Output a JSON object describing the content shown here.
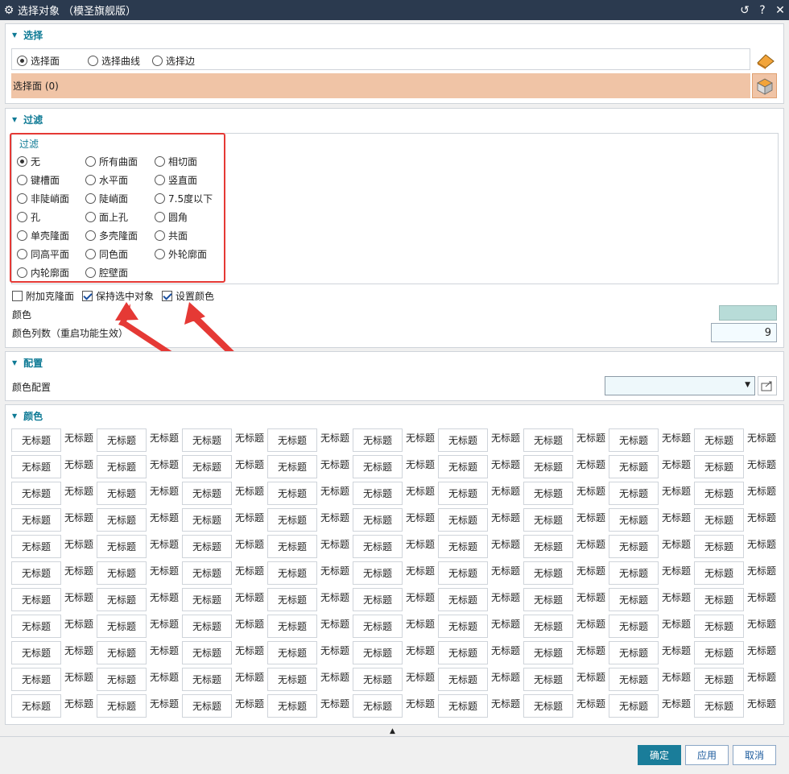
{
  "window": {
    "title": "选择对象 （模圣旗舰版）"
  },
  "select_section": {
    "title": "选择",
    "options": [
      {
        "label": "选择面",
        "selected": true
      },
      {
        "label": "选择曲线",
        "selected": false
      },
      {
        "label": "选择边",
        "selected": false
      }
    ],
    "selection_status": "选择面 (0)",
    "highlight_color": "#f0c4a6"
  },
  "filter_section": {
    "title": "过滤",
    "group_label": "过滤",
    "options": [
      [
        "无",
        "所有曲面",
        "相切面"
      ],
      [
        "键槽面",
        "水平面",
        "竖直面"
      ],
      [
        "非陡峭面",
        "陡峭面",
        "7.5度以下"
      ],
      [
        "孔",
        "面上孔",
        "圆角"
      ],
      [
        "单壳隆面",
        "多壳隆面",
        "共面"
      ],
      [
        "同高平面",
        "同色面",
        "外轮廓面"
      ],
      [
        "内轮廓面",
        "腔壁面",
        ""
      ]
    ],
    "selected": "无",
    "checkboxes": [
      {
        "label": "附加克隆面",
        "checked": false
      },
      {
        "label": "保持选中对象",
        "checked": true
      },
      {
        "label": "设置颜色",
        "checked": true
      }
    ],
    "color_label": "颜色",
    "color_value": "#b8dcd8",
    "color_count_label": "颜色列数（重启功能生效）",
    "color_count_value": "9",
    "annotation_color": "#e53935"
  },
  "config_section": {
    "title": "配置",
    "label": "颜色配置",
    "dropdown_value": ""
  },
  "color_section": {
    "title": "颜色",
    "cell_label": "无标题",
    "rows": 11,
    "columns": 18
  },
  "footer": {
    "ok": "确定",
    "apply": "应用",
    "cancel": "取消"
  },
  "accent_color": "#0e7a95"
}
